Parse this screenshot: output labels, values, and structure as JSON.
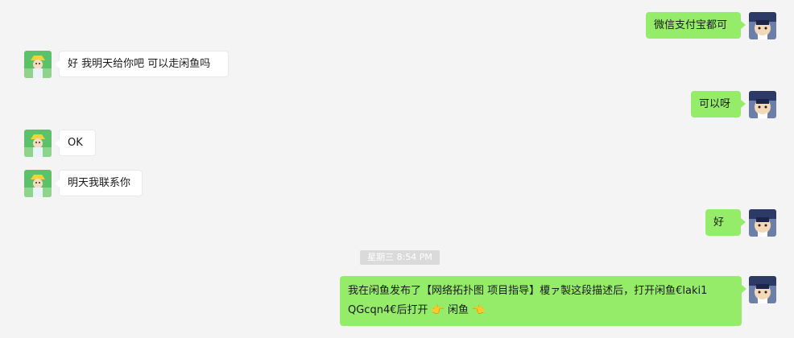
{
  "timestamp": "星期三 8:54 PM",
  "messages": [
    {
      "side": "out",
      "text": "微信支付宝都可"
    },
    {
      "side": "in",
      "text": "好 我明天给你吧 可以走闲鱼吗"
    },
    {
      "side": "out",
      "text": "可以呀"
    },
    {
      "side": "in",
      "text": "OK"
    },
    {
      "side": "in",
      "text": "明天我联系你"
    },
    {
      "side": "out",
      "text": "好"
    },
    {
      "side": "out",
      "line1": "我在闲鱼发布了【网络拓扑图 项目指导】榎ァ製这段描述后，打开闲鱼€laki1",
      "line2": "QGcqn4€后打开 👉 闲鱼 👈"
    }
  ],
  "colors": {
    "outgoing_bubble": "#95ec69",
    "incoming_bubble": "#ffffff",
    "background": "#f4f4f4"
  },
  "icons": {
    "self_avatar": "self-avatar-icon",
    "contact_avatar": "contact-avatar-icon"
  }
}
